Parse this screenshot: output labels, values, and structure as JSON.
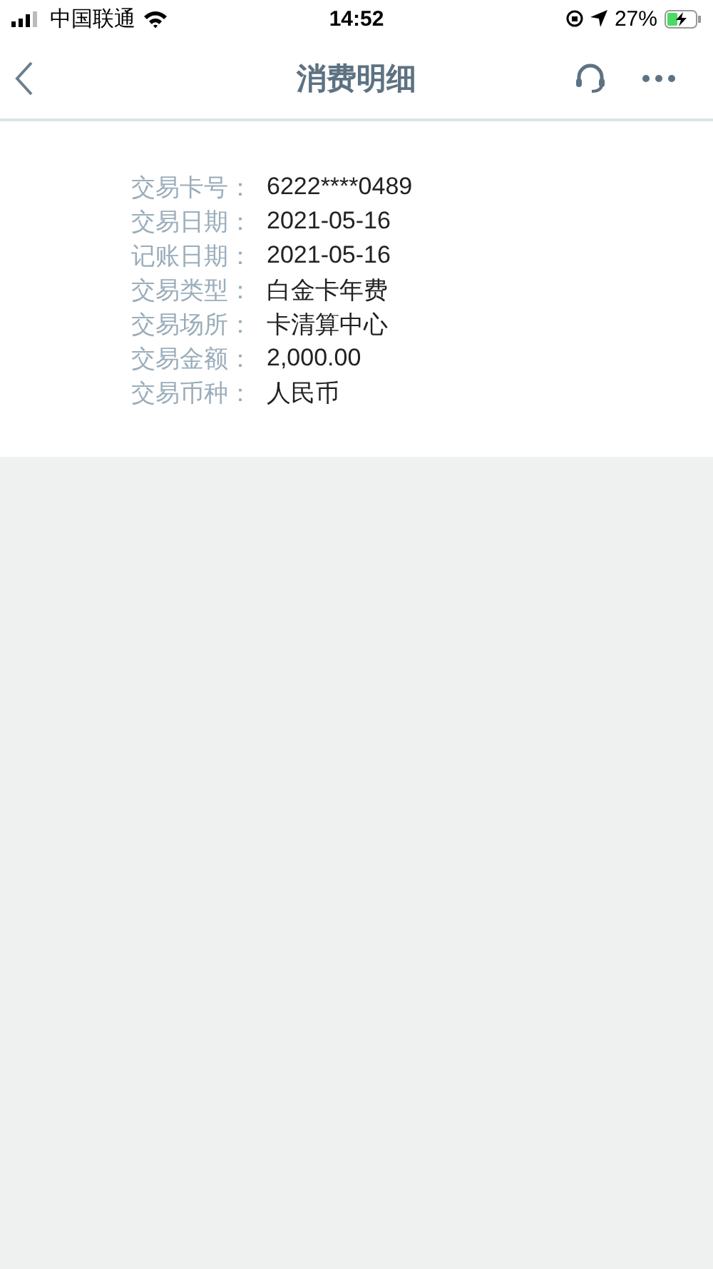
{
  "status_bar": {
    "carrier": "中国联通",
    "time": "14:52",
    "battery": "27%"
  },
  "header": {
    "title": "消费明细"
  },
  "details": [
    {
      "label": "交易卡号：",
      "value": "6222****0489"
    },
    {
      "label": "交易日期：",
      "value": "2021-05-16"
    },
    {
      "label": "记账日期：",
      "value": "2021-05-16"
    },
    {
      "label": "交易类型：",
      "value": "白金卡年费"
    },
    {
      "label": "交易场所：",
      "value": "卡清算中心"
    },
    {
      "label": "交易金额：",
      "value": "2,000.00"
    },
    {
      "label": "交易币种：",
      "value": "人民币"
    }
  ]
}
